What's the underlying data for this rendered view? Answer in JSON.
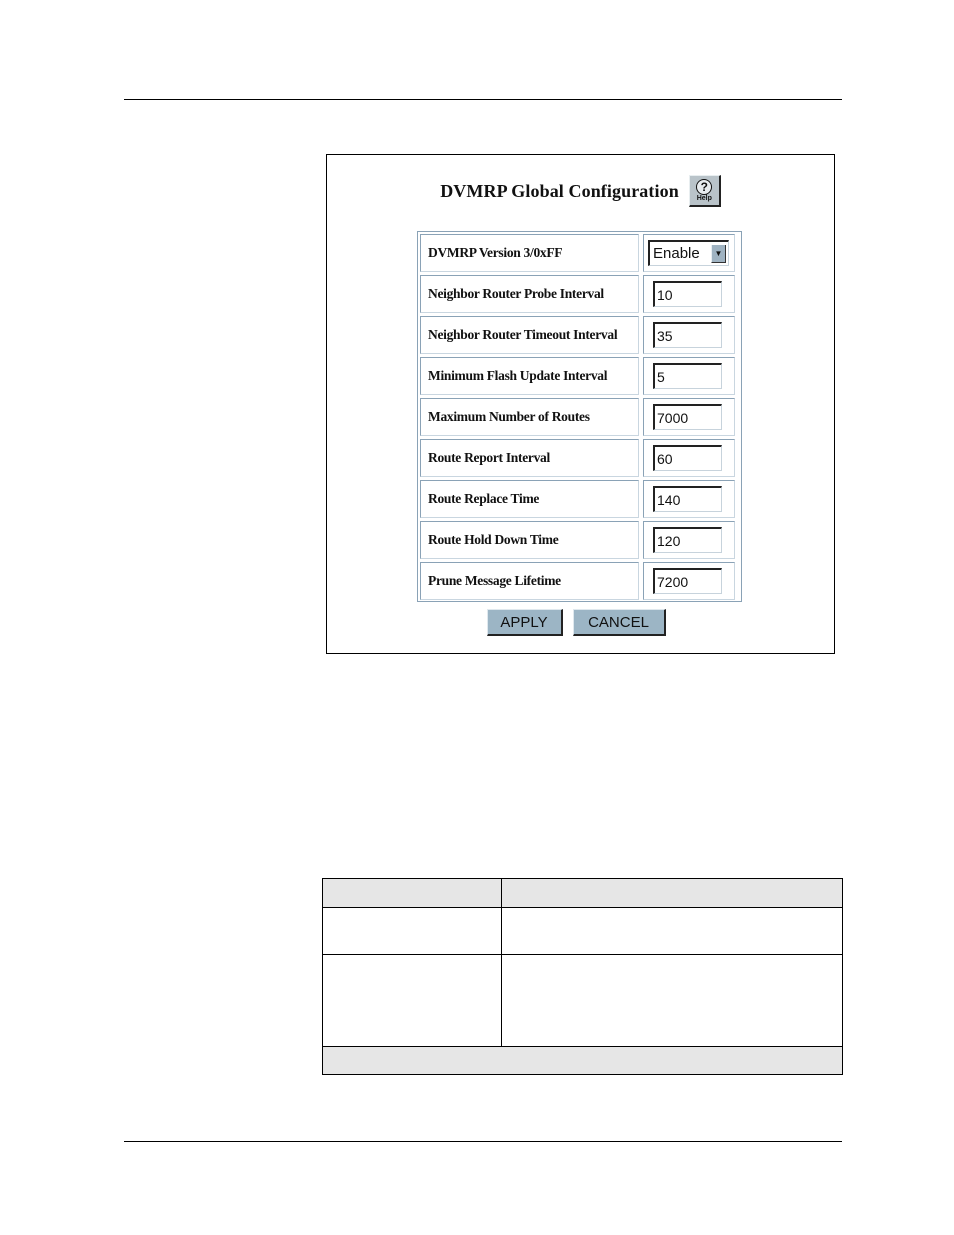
{
  "figure": {
    "title": "DVMRP Global Configuration",
    "help_button": {
      "icon": "help-icon",
      "glyph": "?",
      "label": "Help"
    },
    "fields": [
      {
        "label": "DVMRP Version 3/0xFF",
        "type": "select",
        "value": "Enable"
      },
      {
        "label": "Neighbor Router Probe Interval",
        "type": "text",
        "value": "10"
      },
      {
        "label": "Neighbor Router Timeout Interval",
        "type": "text",
        "value": "35"
      },
      {
        "label": "Minimum Flash Update Interval",
        "type": "text",
        "value": "5"
      },
      {
        "label": "Maximum Number of Routes",
        "type": "text",
        "value": "7000"
      },
      {
        "label": "Route Report Interval",
        "type": "text",
        "value": "60"
      },
      {
        "label": "Route Replace Time",
        "type": "text",
        "value": "140"
      },
      {
        "label": "Route Hold Down Time",
        "type": "text",
        "value": "120"
      },
      {
        "label": "Prune Message Lifetime",
        "type": "text",
        "value": "7200"
      }
    ],
    "buttons": {
      "apply": "APPLY",
      "cancel": "CANCEL"
    },
    "colors": {
      "button_bg": "#9cb5c5",
      "cell_border": "#8aa2b6"
    }
  },
  "doc_table": {
    "header": [
      "",
      ""
    ],
    "rows": [
      [
        "",
        ""
      ],
      [
        "",
        ""
      ]
    ],
    "footer": "",
    "colors": {
      "shaded": "#e6e6e6"
    }
  }
}
